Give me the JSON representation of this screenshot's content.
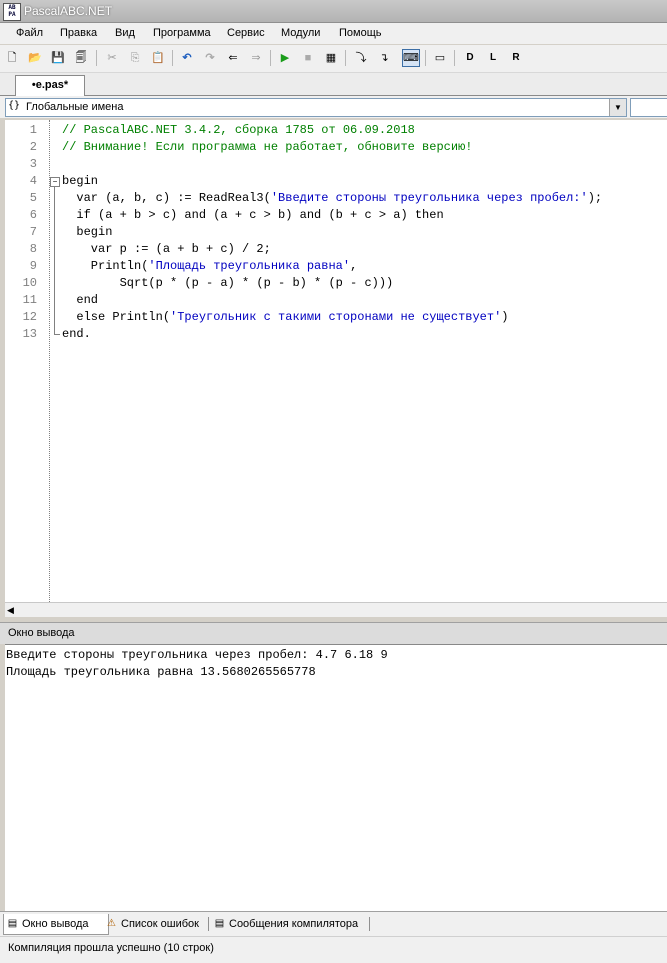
{
  "window": {
    "title": "PascalABC.NET",
    "icon_text": "AB PA"
  },
  "menu": [
    "Файл",
    "Правка",
    "Вид",
    "Программа",
    "Сервис",
    "Модули",
    "Помощь"
  ],
  "toolbar": {
    "buttons": [
      {
        "name": "new-file-icon",
        "glyph": "🗋"
      },
      {
        "name": "open-file-icon",
        "glyph": "📂"
      },
      {
        "name": "save-icon",
        "glyph": "💾"
      },
      {
        "name": "save-all-icon",
        "glyph": "🗐"
      },
      {
        "name": "cut-icon",
        "glyph": "✂"
      },
      {
        "name": "copy-icon",
        "glyph": "⎘"
      },
      {
        "name": "paste-icon",
        "glyph": "📋"
      },
      {
        "name": "undo-icon",
        "glyph": "↶"
      },
      {
        "name": "redo-icon",
        "glyph": "↷"
      },
      {
        "name": "navigate-back-icon",
        "glyph": "⇐"
      },
      {
        "name": "navigate-forward-icon",
        "glyph": "⇒"
      },
      {
        "name": "run-icon",
        "glyph": "▶"
      },
      {
        "name": "stop-icon",
        "glyph": "■"
      },
      {
        "name": "compile-icon",
        "glyph": "▦"
      },
      {
        "name": "step-into-icon",
        "glyph": "⤵"
      },
      {
        "name": "step-over-icon",
        "glyph": "↴"
      },
      {
        "name": "console-icon",
        "glyph": "⌨"
      },
      {
        "name": "window-icon",
        "glyph": "▭"
      },
      {
        "name": "tool-d-icon",
        "glyph": "D"
      },
      {
        "name": "tool-l-icon",
        "glyph": "L"
      },
      {
        "name": "tool-r-icon",
        "glyph": "R"
      }
    ],
    "run_color": "#1a9c1a",
    "undo_color": "#1f5fbf"
  },
  "tab": {
    "label": "•e.pas*"
  },
  "nav": {
    "icon": "{}",
    "text": "Глобальные имена"
  },
  "editor": {
    "line_numbers": [
      "1",
      "2",
      "3",
      "4",
      "5",
      "6",
      "7",
      "8",
      "9",
      "10",
      "11",
      "12",
      "13"
    ],
    "lines": [
      [
        {
          "t": "// PascalABC.NET 3.4.2, сборка 1785 от 06.09.2018",
          "c": "cm"
        }
      ],
      [
        {
          "t": "// Внимание! Если программа не работает, обновите версию!",
          "c": "cm"
        }
      ],
      [
        {
          "t": "",
          "c": "kw"
        }
      ],
      [
        {
          "t": "begin",
          "c": "kw"
        }
      ],
      [
        {
          "t": "  var (a, b, c) := ReadReal3(",
          "c": "kw"
        },
        {
          "t": "'Введите стороны треугольника через пробел:'",
          "c": "st"
        },
        {
          "t": ");",
          "c": "kw"
        }
      ],
      [
        {
          "t": "  if (a + b > c) and (a + c > b) and (b + c > a) then",
          "c": "kw"
        }
      ],
      [
        {
          "t": "  begin",
          "c": "kw"
        }
      ],
      [
        {
          "t": "    var p := (a + b + c) / 2;",
          "c": "kw"
        }
      ],
      [
        {
          "t": "    Println(",
          "c": "kw"
        },
        {
          "t": "'Площадь треугольника равна'",
          "c": "st"
        },
        {
          "t": ",",
          "c": "kw"
        }
      ],
      [
        {
          "t": "        Sqrt(p * (p - a) * (p - b) * (p - c)))",
          "c": "kw"
        }
      ],
      [
        {
          "t": "  end",
          "c": "kw"
        }
      ],
      [
        {
          "t": "  else Println(",
          "c": "kw"
        },
        {
          "t": "'Треугольник с такими сторонами не существует'",
          "c": "st"
        },
        {
          "t": ")",
          "c": "kw"
        }
      ],
      [
        {
          "t": "end.",
          "c": "kw"
        }
      ]
    ],
    "fold_symbol": "−"
  },
  "output_panel": {
    "title": "Окно вывода",
    "lines": [
      "Введите стороны треугольника через пробел: 4.7 6.18 9",
      "Площадь треугольника равна 13.5680265565778"
    ]
  },
  "bottom_tabs": [
    {
      "label": "Окно вывода",
      "icon": "▤",
      "active": true
    },
    {
      "label": "Список ошибок",
      "icon": "⚠",
      "active": false
    },
    {
      "label": "Сообщения компилятора",
      "icon": "▤",
      "active": false
    }
  ],
  "status": "Компиляция прошла успешно (10 строк)"
}
